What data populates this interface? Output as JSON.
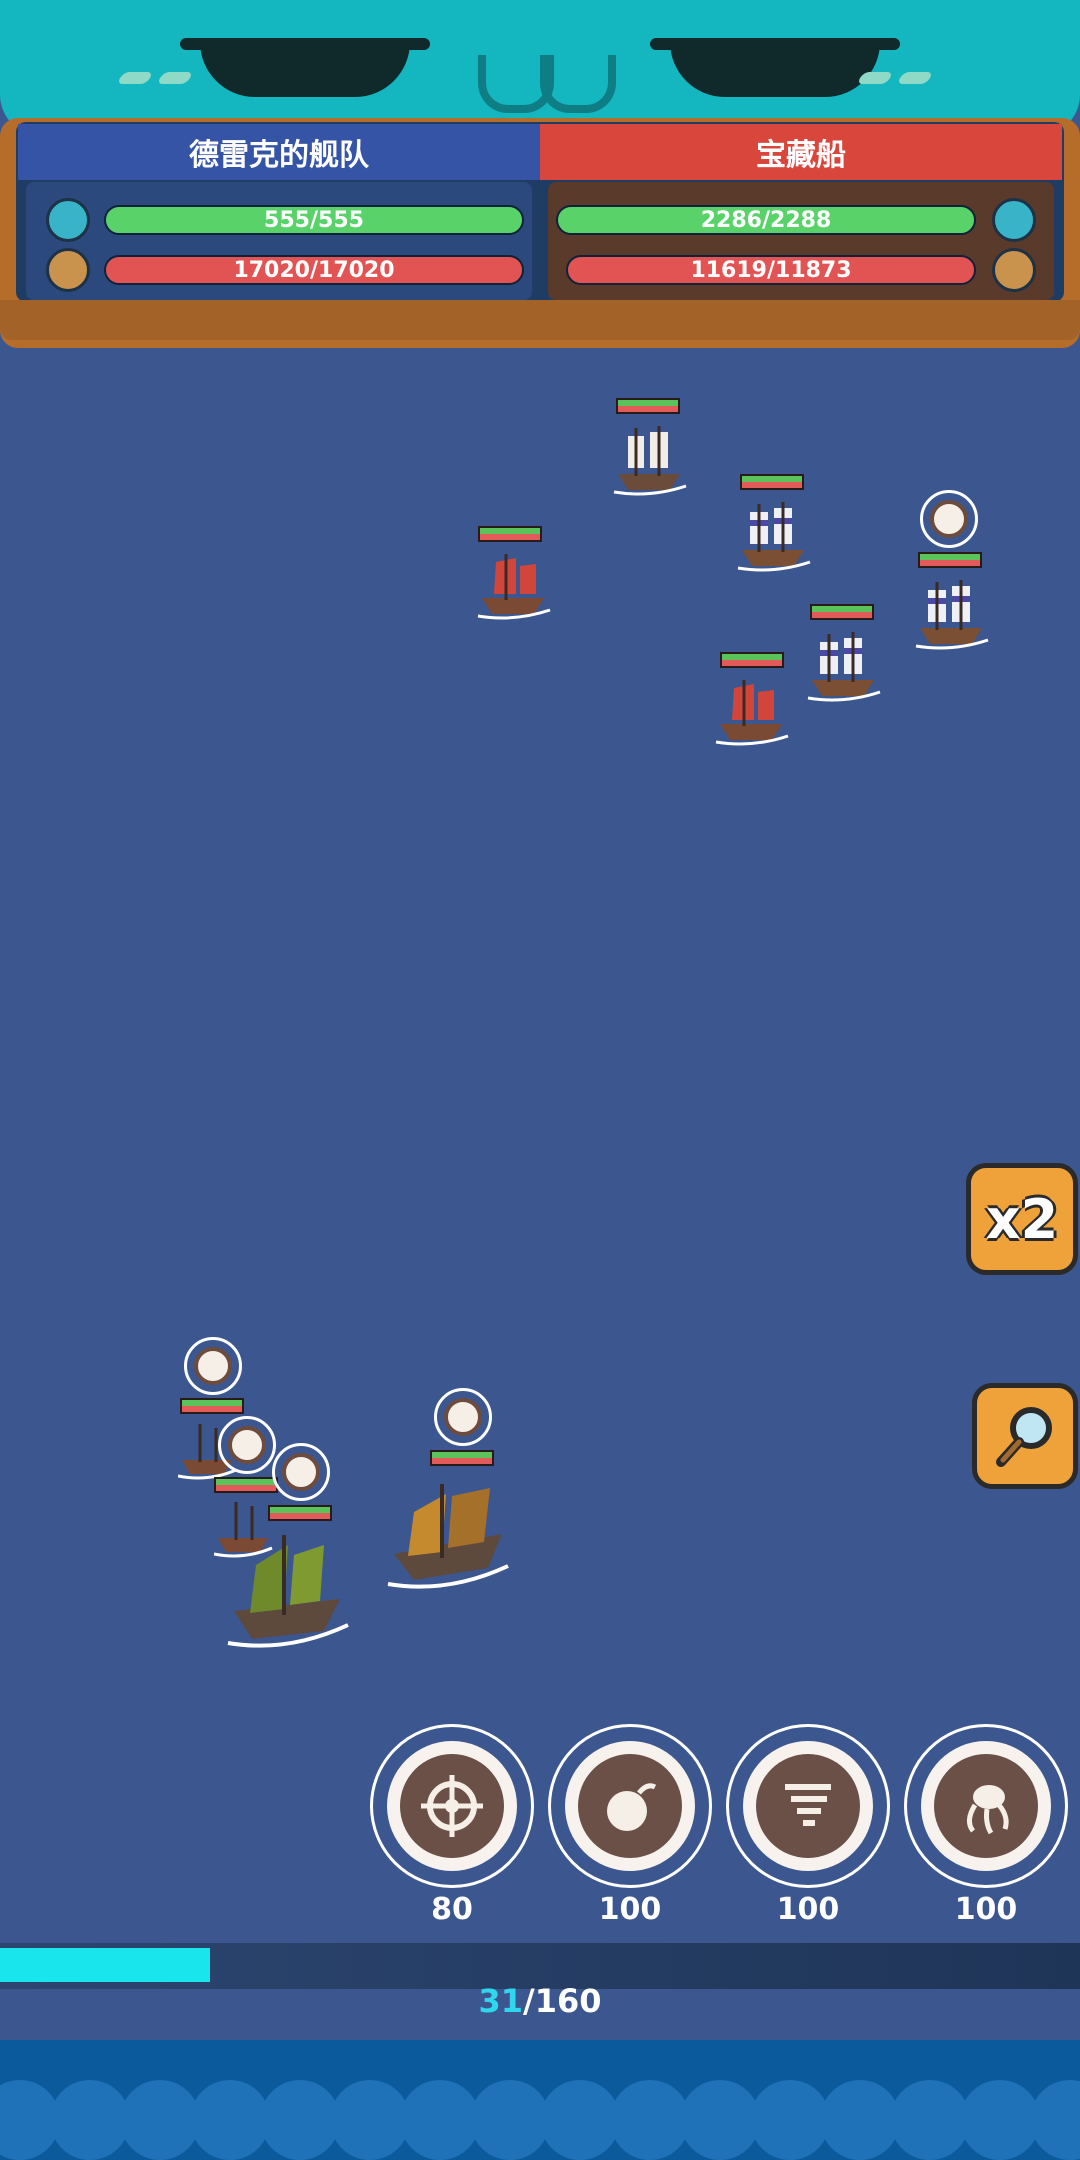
{
  "teams": {
    "left": {
      "name": "德雷克的舰队",
      "crew_hp": "555/555",
      "ship_hp": "17020/17020"
    },
    "right": {
      "name": "宝藏船",
      "crew_hp": "2286/2288",
      "ship_hp": "11619/11873"
    }
  },
  "controls": {
    "speed_label": "x2"
  },
  "skills": [
    {
      "icon": "helm-wheel-icon",
      "cost": "80"
    },
    {
      "icon": "bomb-icon",
      "cost": "100"
    },
    {
      "icon": "tornado-icon",
      "cost": "100"
    },
    {
      "icon": "kraken-icon",
      "cost": "100"
    }
  ],
  "progress": {
    "current": "31",
    "total": "160",
    "separator": "/",
    "fraction": 0.194
  },
  "colors": {
    "sea": "#3c578f",
    "left_team": "#3554a6",
    "right_team": "#d9463c",
    "hp_green": "#5ad26a",
    "hp_red": "#e25454",
    "progress": "#18e6ec"
  }
}
